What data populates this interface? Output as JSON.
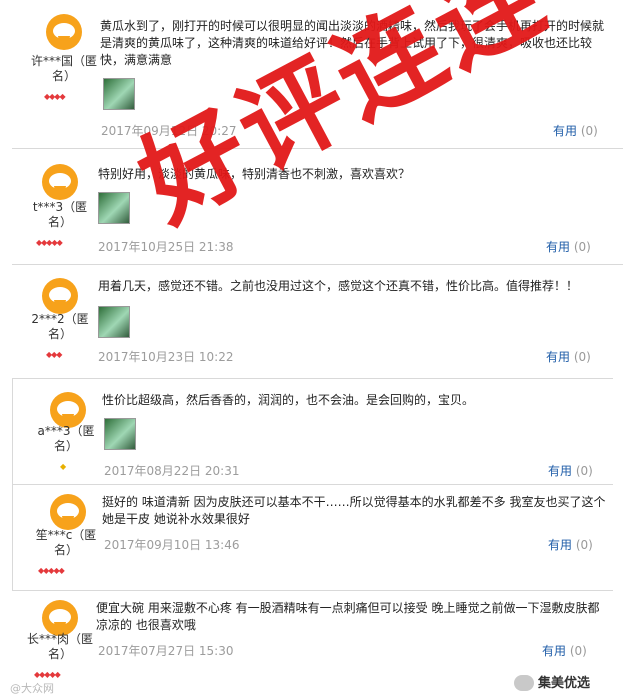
{
  "reviews": [
    {
      "user": "许***国（匿名）",
      "text": "黄瓜水到了，刚打开的时候可以很明显的闻出淡淡的酒精味，然后我玩了会手机再打开的时候就是清爽的黄瓜味了，这种清爽的味道给好评！然后在手背上试用了下，很清爽，吸收也还比较快，满意满意",
      "date": "2017年09月12日 20:27",
      "useful": "有用",
      "count": "(0)"
    },
    {
      "user": "t***3（匿名）",
      "text": "特别好用，淡淡的黄瓜味，特别清香也不刺激，喜欢喜欢？",
      "date": "2017年10月25日 21:38",
      "useful": "有用",
      "count": "(0)"
    },
    {
      "user": "2***2（匿名）",
      "text": "用着几天，感觉还不错。之前也没用过这个，感觉这个还真不错，性价比高。值得推荐！！",
      "date": "2017年10月23日 10:22",
      "useful": "有用",
      "count": "(0)"
    },
    {
      "user": "a***3（匿名）",
      "text": "性价比超级高，然后香香的，润润的，也不会油。是会回购的，宝贝。",
      "date": "2017年08月22日 20:31",
      "useful": "有用",
      "count": "(0)"
    },
    {
      "user": "笙***c（匿名）",
      "text": "挺好的 味道清新 因为皮肤还可以基本不干……所以觉得基本的水乳都差不多 我室友也买了这个 她是干皮 她说补水效果很好",
      "date": "2017年09月10日 13:46",
      "useful": "有用",
      "count": "(0)"
    },
    {
      "user": "长***肉（匿名）",
      "text": "便宜大碗 用来湿敷不心疼 有一股酒精味有一点刺痛但可以接受 晚上睡觉之前做一下湿敷皮肤都凉凉的 也很喜欢哦",
      "date": "2017年07月27日 15:30",
      "useful": "有用",
      "count": "(0)"
    }
  ],
  "stamp": "好评连连",
  "watermark": "@大众网",
  "brand": "集美优选"
}
